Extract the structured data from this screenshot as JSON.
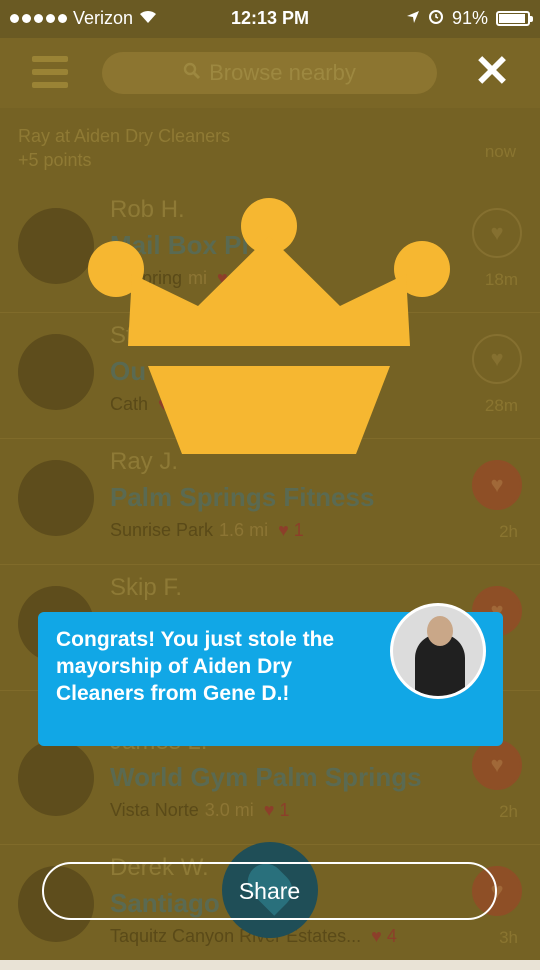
{
  "status_bar": {
    "carrier": "Verizon",
    "time": "12:13 PM",
    "battery": "91%"
  },
  "navbar": {
    "search_placeholder": "Browse nearby"
  },
  "feed": {
    "notice_title": "Ray at Aiden Dry Cleaners",
    "notice_points": "+5 points",
    "notice_time": "now",
    "rows": [
      {
        "name": "Rob H.",
        "venue": "Mail Box Pl",
        "area": "m Spring",
        "distance": "mi",
        "likes": "1",
        "ago": "18m",
        "liked": false
      },
      {
        "name": "Steven C.",
        "venue": "Ou",
        "area": "Cath",
        "distance": "",
        "likes": "1",
        "ago": "28m",
        "liked": false
      },
      {
        "name": "Ray J.",
        "venue": "Palm Springs Fitness",
        "area": "Sunrise Park",
        "distance": "1.6 mi",
        "likes": "1",
        "ago": "2h",
        "liked": true
      },
      {
        "name": "Skip F.",
        "venue": "",
        "area": "",
        "distance": "",
        "likes": "",
        "ago": "",
        "liked": true
      },
      {
        "name": "James L.",
        "venue": "World Gym Palm Springs",
        "area": "Vista Norte",
        "distance": "3.0 mi",
        "likes": "1",
        "ago": "2h",
        "liked": true
      },
      {
        "name": "Derek W.",
        "venue": "Santiago",
        "area": "Taquitz Canyon River Estates...",
        "distance": "",
        "likes": "4",
        "ago": "3h",
        "liked": true
      }
    ]
  },
  "congrats": {
    "message": "Congrats! You just stole the mayorship of Aiden Dry Cleaners from Gene D.!"
  },
  "share": {
    "label": "Share"
  },
  "colors": {
    "crown": "#f6b731",
    "congrats_bg": "#11a7e6",
    "overlay_tint": "#756224"
  }
}
